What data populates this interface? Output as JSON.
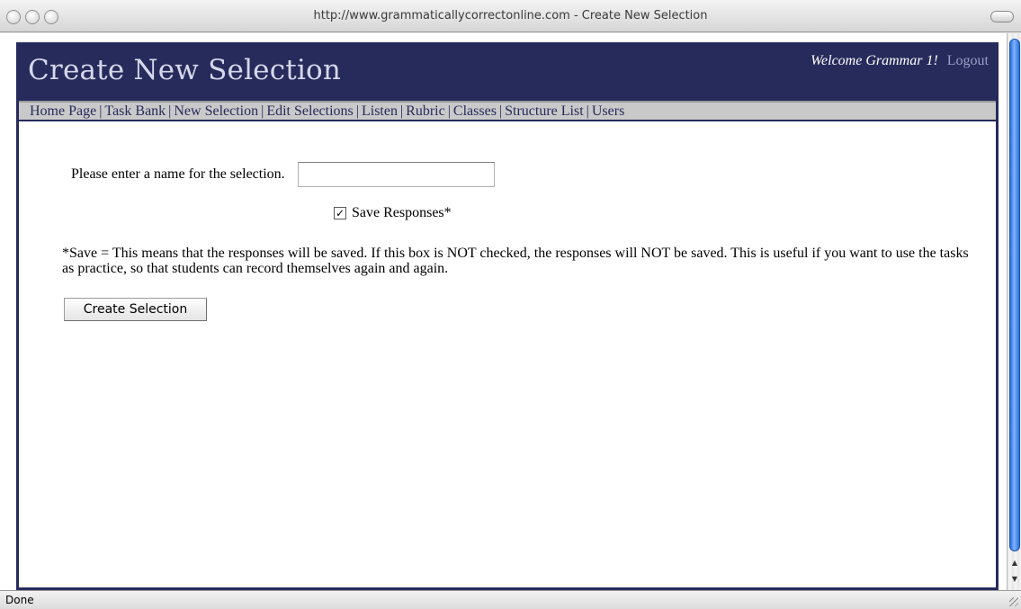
{
  "window": {
    "title": "http://www.grammaticallycorrectonline.com - Create New Selection"
  },
  "header": {
    "page_title": "Create New Selection",
    "welcome": "Welcome Grammar 1!",
    "logout": "Logout"
  },
  "nav": {
    "separator": "|",
    "items": [
      {
        "label": "Home Page"
      },
      {
        "label": "Task Bank"
      },
      {
        "label": "New Selection"
      },
      {
        "label": "Edit Selections"
      },
      {
        "label": "Listen"
      },
      {
        "label": "Rubric"
      },
      {
        "label": "Classes"
      },
      {
        "label": "Structure List"
      },
      {
        "label": "Users"
      }
    ]
  },
  "form": {
    "name_label": "Please enter a name for the selection.",
    "name_value": "",
    "save_checkbox_checked": true,
    "save_checkbox_glyph": "✓",
    "save_label": "Save Responses*",
    "note": "*Save = This means that the responses will be saved. If this box is NOT checked, the responses will NOT be saved. This is useful if you want to use the tasks as practice, so that students can record themselves again and again.",
    "submit_label": "Create Selection"
  },
  "status": {
    "text": "Done"
  },
  "colors": {
    "header_bg": "#272b5c",
    "nav_bg": "#c9c9c9",
    "title_text": "#d6d8ea",
    "logout_text": "#9a9ec6"
  }
}
